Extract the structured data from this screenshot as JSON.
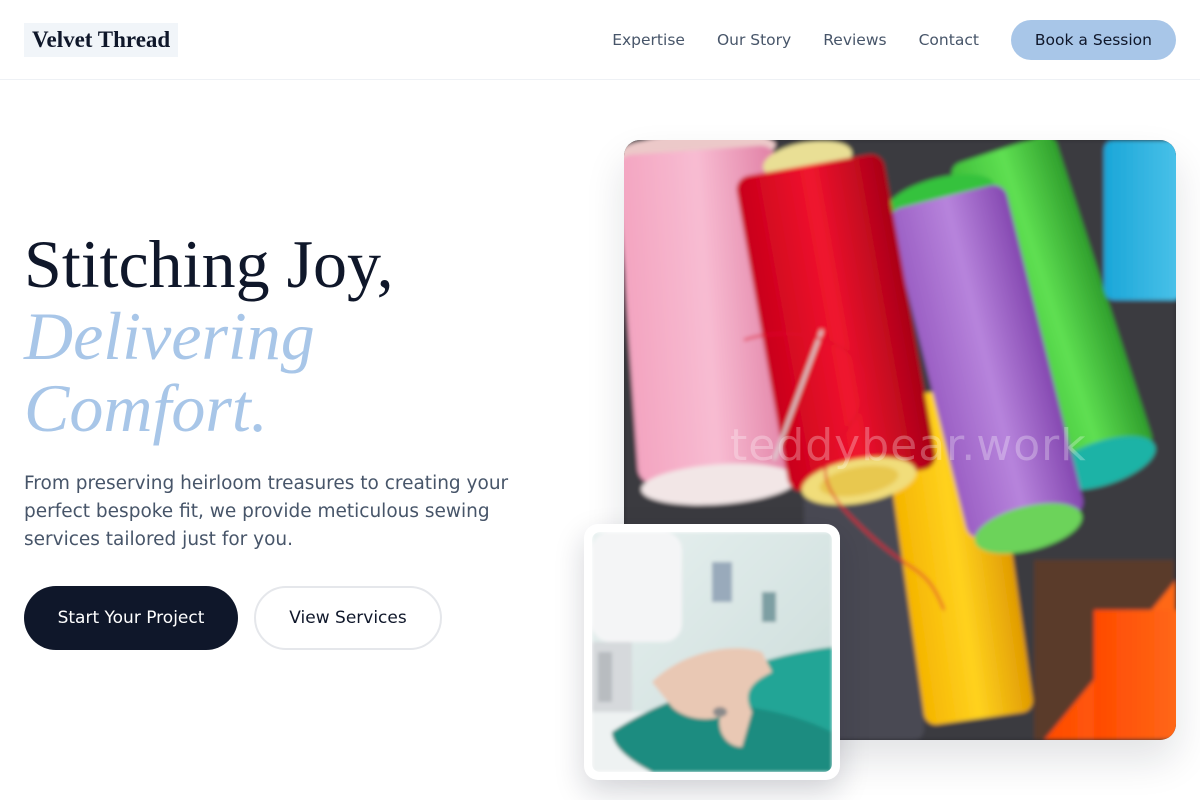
{
  "header": {
    "logo": "Velvet Thread",
    "nav": [
      "Expertise",
      "Our Story",
      "Reviews",
      "Contact"
    ],
    "cta": "Book a Session"
  },
  "hero": {
    "title_line1": "Stitching Joy,",
    "title_line2": "Delivering",
    "title_line3": "Comfort.",
    "description": "From preserving heirloom treasures to creating your perfect bespoke fit, we provide meticulous sewing services tailored just for you.",
    "primary_button": "Start Your Project",
    "secondary_button": "View Services"
  },
  "images": {
    "main_watermark": "teddybear.work"
  },
  "colors": {
    "accent": "#a8c6e8",
    "dark": "#0f172a",
    "muted_text": "#475569"
  }
}
